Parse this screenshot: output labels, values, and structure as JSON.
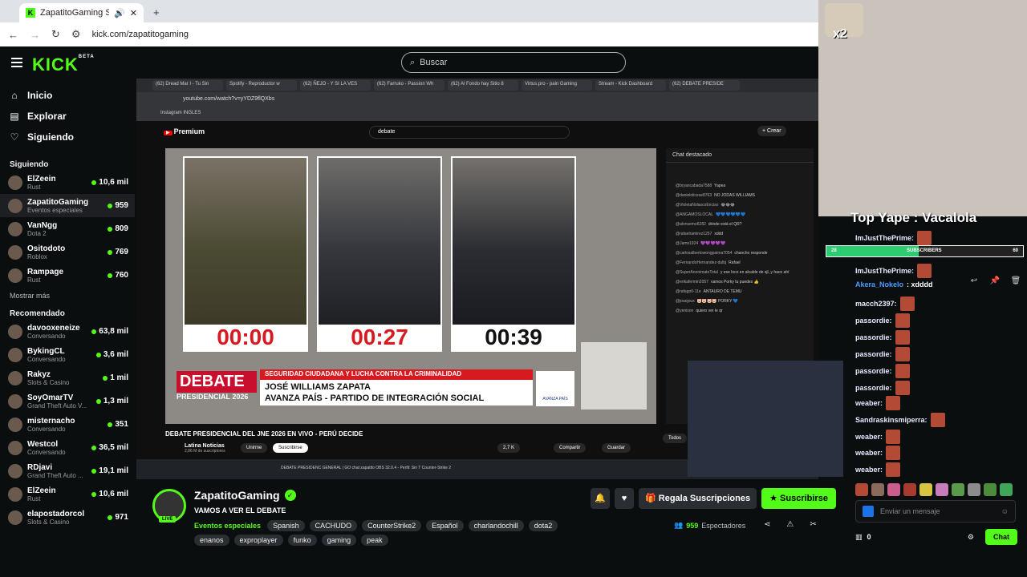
{
  "browser": {
    "tab_title": "ZapatitoGaming Stream - V",
    "url": "kick.com/zapatitogaming"
  },
  "kick": {
    "logo": "KICK",
    "logo_badge": "BETA",
    "search_placeholder": "Buscar"
  },
  "sidebar": {
    "nav": [
      {
        "label": "Inicio",
        "icon": "home-icon"
      },
      {
        "label": "Explorar",
        "icon": "compass-icon"
      },
      {
        "label": "Siguiendo",
        "icon": "heart-icon"
      }
    ],
    "following_title": "Siguiendo",
    "following": [
      {
        "name": "ElZeein",
        "category": "Rust",
        "viewers": "10,6 mil"
      },
      {
        "name": "ZapatitoGaming",
        "category": "Eventos especiales",
        "viewers": "959"
      },
      {
        "name": "VanNgg",
        "category": "Dota 2",
        "viewers": "809"
      },
      {
        "name": "Ositodoto",
        "category": "Roblox",
        "viewers": "769"
      },
      {
        "name": "Rampage",
        "category": "Rust",
        "viewers": "760"
      }
    ],
    "show_more": "Mostrar más",
    "recommended_title": "Recomendado",
    "recommended": [
      {
        "name": "davooxeneize",
        "category": "Conversando",
        "viewers": "63,8 mil"
      },
      {
        "name": "BykingCL",
        "category": "Conversando",
        "viewers": "3,6 mil"
      },
      {
        "name": "Rakyz",
        "category": "Slots & Casino",
        "viewers": "1 mil"
      },
      {
        "name": "SoyOmarTV",
        "category": "Grand Theft Auto V...",
        "viewers": "1,3 mil"
      },
      {
        "name": "misternacho",
        "category": "Conversando",
        "viewers": "351"
      },
      {
        "name": "Westcol",
        "category": "Conversando",
        "viewers": "36,5 mil"
      },
      {
        "name": "RDjavi",
        "category": "Grand Theft Auto ...",
        "viewers": "19,1 mil"
      },
      {
        "name": "ElZeein",
        "category": "Rust",
        "viewers": "10,6 mil"
      },
      {
        "name": "elapostadorcol",
        "category": "Slots & Casino",
        "viewers": "971"
      }
    ]
  },
  "stream_content": {
    "inner_tabs": [
      "(62) Dread Mar I - Tu Sin",
      "Spotify - Reproductor w",
      "(62) ÑEJO - Y SI LA VES",
      "(62) Farruko - Passion Wh",
      "(62) Al Fondo hay Sitio 8",
      "Virtus.pro - pain Gaming",
      "Stream - Kick Dashboard",
      "(62) DEBATE PRESIDE"
    ],
    "inner_url": "youtube.com/watch?v=yYDZ9flQXbs",
    "inner_bookmarks": "Instagram   INGLES",
    "yt_logo": "Premium",
    "yt_search": "debate",
    "yt_crear": "+ Crear",
    "timers": [
      "00:00",
      "00:27",
      "00:39"
    ],
    "debate_label": "DEBATE",
    "presidencial_label": "PRESIDENCIAL 2026",
    "topic": "SEGURIDAD CIUDADANA Y LUCHA CONTRA LA CRIMINALIDAD",
    "speaker": "JOSÉ WILLIAMS ZAPATA",
    "party": "AVANZA PAÍS - PARTIDO DE INTEGRACIÓN SOCIAL",
    "party_logo": "AVANZA PAÍS",
    "video_title": "DEBATE PRESIDENCIAL DEL JNE 2026 EN VIVO - PERÚ DECIDE",
    "yt_channel": "Latina Noticias",
    "yt_subs": "2,86 M de suscriptores",
    "yt_buttons": [
      "Unirme",
      "Suscribirse",
      "2,7 K",
      "Compartir",
      "Guardar",
      "Todos"
    ],
    "yt_chat_title": "Chat destacado",
    "yt_chat": [
      {
        "user": "@bryancabada7588",
        "text": "Yapea"
      },
      {
        "user": "@danielolicese8763",
        "text": "NO JODAS WILLIAMS"
      },
      {
        "user": "@VioletaNolascoEnciso",
        "text": "😂😂😂"
      },
      {
        "user": "@ANGAMOSLOCAL",
        "text": "💙💙💙💙💙💙"
      },
      {
        "user": "@alonsemo6282",
        "text": "dónde está el QR?"
      },
      {
        "user": "@rafaelramirez1257",
        "text": "xddd"
      },
      {
        "user": "@Jams1924",
        "text": "💜💜💜💜💜"
      },
      {
        "user": "@carlosalbertowongpaima7054",
        "text": "chancho responde"
      },
      {
        "user": "@FernandoHernandez-dulbj",
        "text": "Rafael"
      },
      {
        "user": "@SuperAnonimatoTotal",
        "text": "y ese loco en alcalde de sjl, y hace ahí"
      },
      {
        "user": "@erikafermin2057",
        "text": "vamos Porky tu puedes 👍"
      },
      {
        "user": "@rafago0-11e",
        "text": "ANTAURO DE TEMU"
      },
      {
        "user": "@joaojoux",
        "text": "🐷🐷🐷🐷 PORKY 💙"
      },
      {
        "user": "@yenison",
        "text": "quiero ver le qr"
      }
    ],
    "taskbar": "DEBATE PRESIDENC   GENERAL | GO   chat zapatito   OBS 32.0.4 - Perfil: Sin T   Counter-Strike 2"
  },
  "overlay": {
    "multiplier": "x2",
    "top_yape": "Top Yape : Vacalola",
    "sub_goal": {
      "left": "28",
      "label": "SUBSCRIBERS",
      "right": "60",
      "progress": 0.47
    }
  },
  "chat": {
    "messages": [
      {
        "user": "ImJustThePrime:",
        "text": ""
      },
      {
        "user": "ImJustThePrime:",
        "text": ""
      },
      {
        "user": "Akera_Nokelo",
        "text": ": xdddd"
      },
      {
        "user": "macch2397:",
        "text": ""
      },
      {
        "user": "passordie:",
        "text": ""
      },
      {
        "user": "passordie:",
        "text": ""
      },
      {
        "user": "passordie:",
        "text": ""
      },
      {
        "user": "passordie:",
        "text": ""
      },
      {
        "user": "passordie:",
        "text": ""
      },
      {
        "user": "weaber:",
        "text": ""
      },
      {
        "user": "Sandraskinsmiperra:",
        "text": ""
      },
      {
        "user": "weaber:",
        "text": ""
      },
      {
        "user": "weaber:",
        "text": ""
      },
      {
        "user": "weaber:",
        "text": ""
      }
    ],
    "input_placeholder": "Enviar un mensaje",
    "points": "0",
    "send_label": "Chat"
  },
  "channel_info": {
    "name": "ZapatitoGaming",
    "live_label": "LIVE",
    "title": "VAMOS A VER EL DEBATE",
    "category": "Eventos especiales",
    "tags": [
      "Spanish",
      "CACHUDO",
      "CounterStrike2",
      "Español",
      "charlandochill",
      "dota2",
      "enanos",
      "exproplayer",
      "funko",
      "gaming",
      "peak"
    ],
    "gift_label": "Regala Suscripciones",
    "subscribe_label": "Suscribirse",
    "viewers": "959",
    "viewers_label": "Espectadores"
  },
  "colors": {
    "accent": "#53fc18",
    "background": "#0b0e0f",
    "debate_red": "#d71920"
  }
}
